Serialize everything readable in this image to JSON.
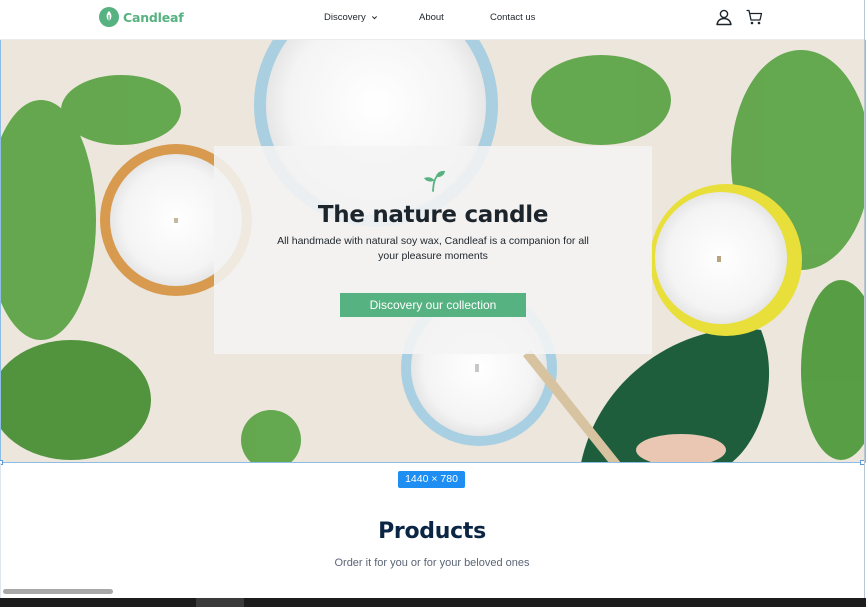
{
  "brand": {
    "name": "Candleaf",
    "logo_icon": "candle-leaf-logo",
    "accent": "#56b280"
  },
  "nav": {
    "items": [
      {
        "label": "Discovery",
        "has_dropdown": true
      },
      {
        "label": "About"
      },
      {
        "label": "Contact us"
      }
    ],
    "icons": [
      "user-icon",
      "cart-icon"
    ]
  },
  "hero": {
    "icon": "sprout-icon",
    "title": "The nature candle",
    "subtitle": "All handmade with natural soy wax, Candleaf is a companion for all your pleasure moments",
    "cta_label": "Discovery our collection"
  },
  "frame_badge": "1440 × 780",
  "products": {
    "title": "Products",
    "subtitle": "Order it for you or for your beloved ones"
  },
  "colors": {
    "text_dark": "#1d252c",
    "heading_navy": "#0b2545",
    "muted": "#5b6575",
    "selection_blue": "#1e8ef2"
  }
}
